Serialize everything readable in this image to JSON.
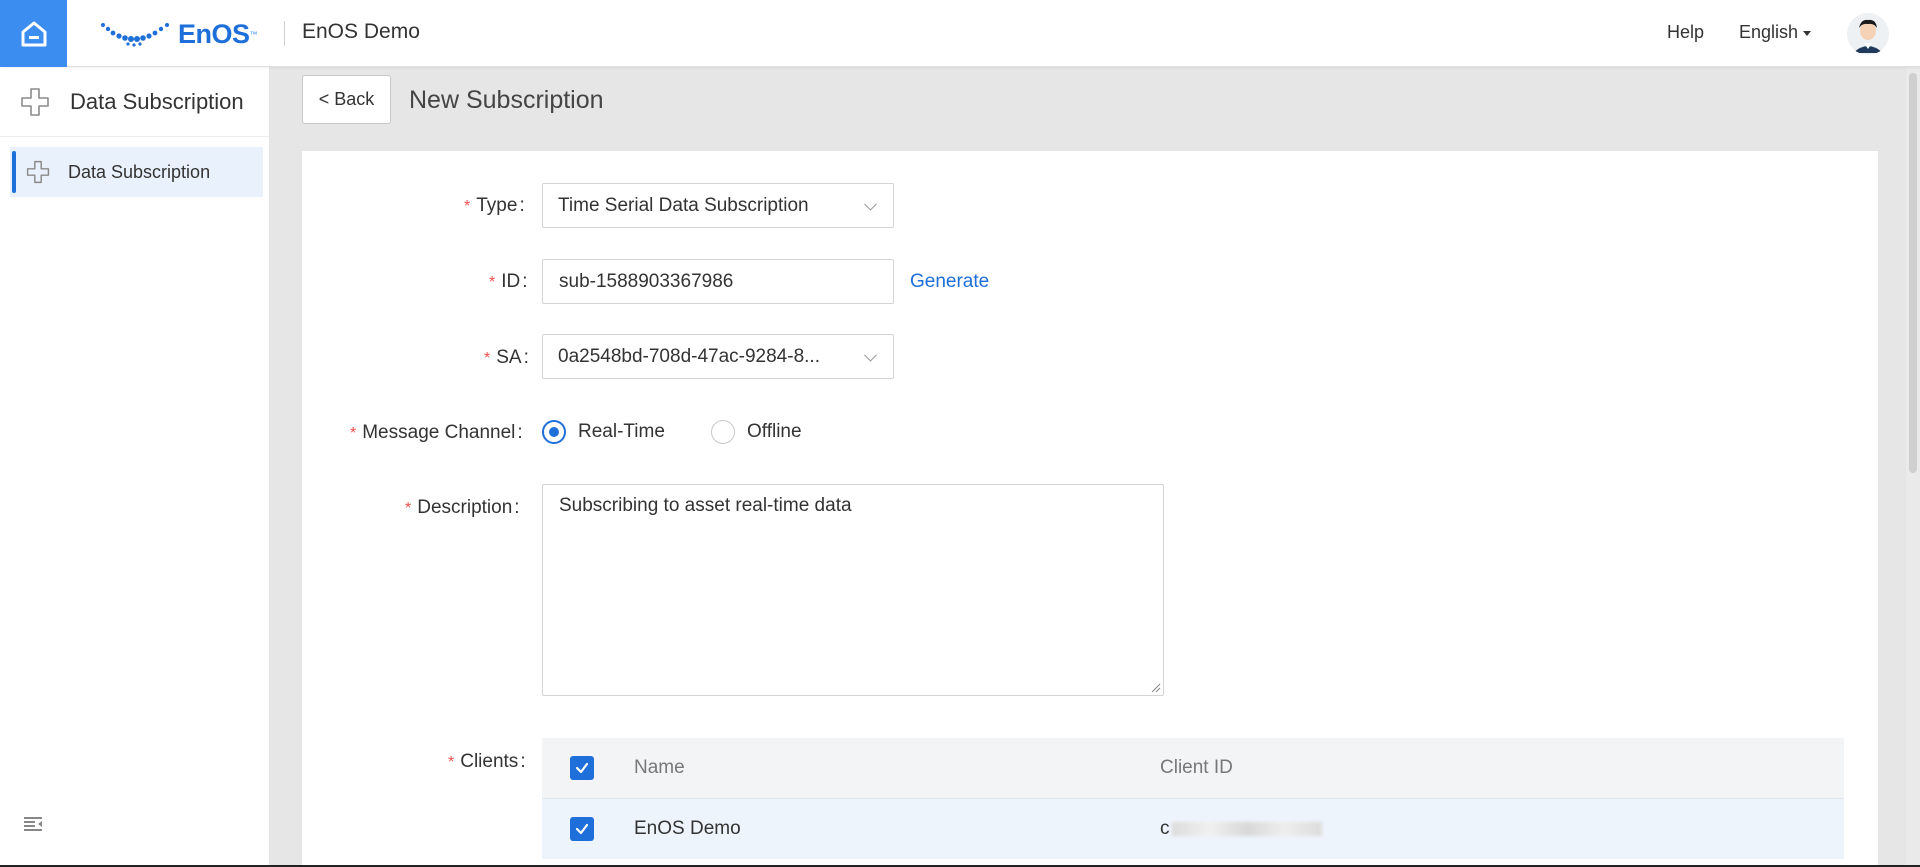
{
  "topbar": {
    "logo_text": "EnOS",
    "app_title": "EnOS Demo",
    "help_label": "Help",
    "language_label": "English"
  },
  "sidebar": {
    "header_title": "Data Subscription",
    "items": [
      {
        "label": "Data Subscription",
        "active": true
      }
    ]
  },
  "page": {
    "back_label": "< Back",
    "title": "New Subscription"
  },
  "form": {
    "type_label": "Type",
    "type_value": "Time Serial Data Subscription",
    "id_label": "ID",
    "id_value": "sub-1588903367986",
    "generate_label": "Generate",
    "sa_label": "SA",
    "sa_value": "0a2548bd-708d-47ac-9284-8...",
    "channel_label": "Message Channel",
    "channel_options": [
      "Real-Time",
      "Offline"
    ],
    "channel_selected": "Real-Time",
    "description_label": "Description",
    "description_value": "Subscribing to asset real-time data",
    "clients_label": "Clients"
  },
  "clients_table": {
    "columns": [
      "Name",
      "Client ID"
    ],
    "rows": [
      {
        "name": "EnOS Demo",
        "client_id_visible": "c",
        "checked": true
      }
    ],
    "header_checked": true
  },
  "colors": {
    "accent": "#1e6fd9",
    "home_button": "#3b8ef0",
    "required": "#f0504d",
    "background": "#e6e6e6"
  }
}
